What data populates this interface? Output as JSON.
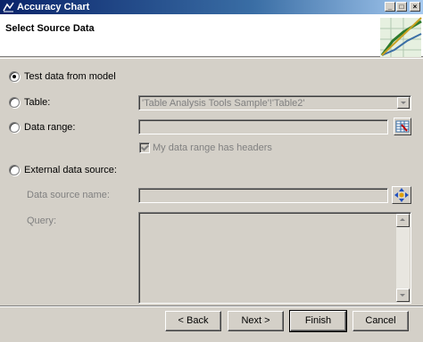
{
  "window": {
    "title": "Accuracy Chart"
  },
  "header": {
    "title": "Select Source Data"
  },
  "options": {
    "test_data": {
      "label": "Test data from model",
      "selected": true
    },
    "table": {
      "label": "Table:",
      "selected": false,
      "value": "'Table Analysis Tools Sample'!'Table2'"
    },
    "data_range": {
      "label": "Data range:",
      "selected": false,
      "value": "",
      "headers_label": "My data range has headers",
      "headers_checked": true
    },
    "external": {
      "label": "External data source:",
      "selected": false,
      "source_name_label": "Data source name:",
      "source_name_value": "",
      "query_label": "Query:",
      "query_value": ""
    }
  },
  "buttons": {
    "back": "< Back",
    "next": "Next >",
    "finish": "Finish",
    "cancel": "Cancel"
  }
}
